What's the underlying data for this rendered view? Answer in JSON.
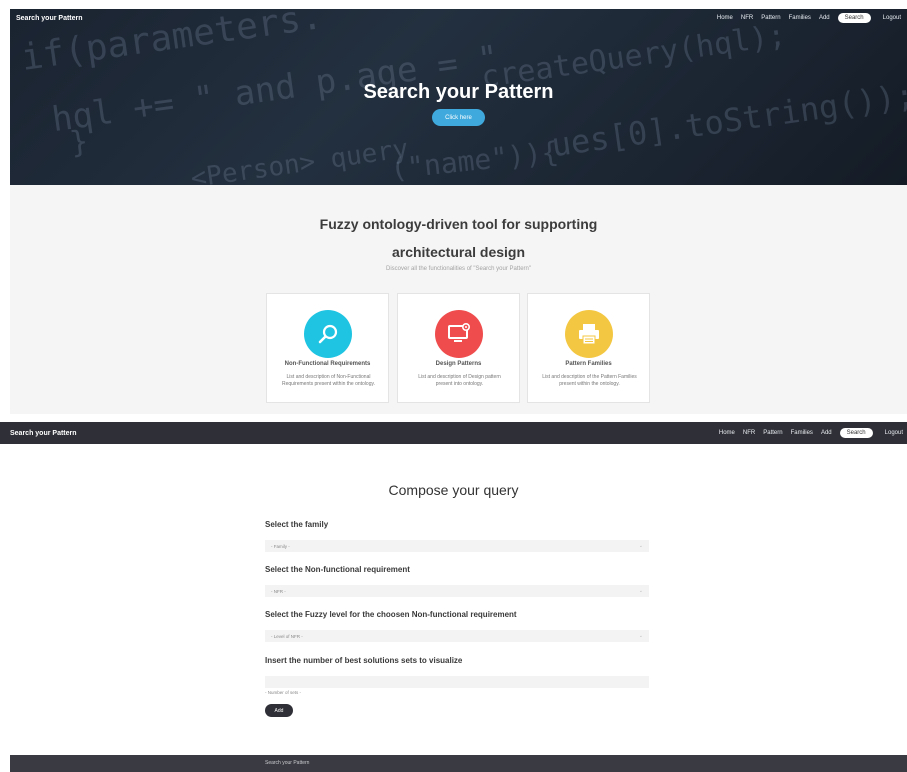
{
  "top_nav": {
    "brand": "Search your Pattern",
    "links": [
      "Home",
      "NFR",
      "Pattern",
      "Families",
      "Add"
    ],
    "search_label": "Search",
    "logout_label": "Logout"
  },
  "hero": {
    "code_text": [
      "if(parameters.",
      "hql += \" and p.age = \"",
      "}",
      "createQuery(hql);",
      "ues[0].toString());",
      "(\"name\")){",
      "<Person> query"
    ],
    "title": "Search your Pattern",
    "button_label": "Click here"
  },
  "features": {
    "title_line1": "Fuzzy ontology-driven tool for supporting",
    "title_line2": "architectural design",
    "subtitle": "Discover all the functionalities of \"Search your Pattern\"",
    "cards": [
      {
        "title": "Non-Functional Requirements",
        "description": "List and description of Non-Functional Requirements present within the ontology.",
        "icon": "search-icon",
        "color": "#1fc4e2"
      },
      {
        "title": "Design Patterns",
        "description": "List and description of Design pattern present into ontology.",
        "icon": "monitor-gear-icon",
        "color": "#ef4d4d"
      },
      {
        "title": "Pattern Families",
        "description": "List and description of the Pattern Families present within the ontology.",
        "icon": "printer-icon",
        "color": "#f4c742"
      }
    ]
  },
  "query": {
    "title": "Compose your query",
    "family_label": "Select the family",
    "family_placeholder": "- Family -",
    "nfr_label": "Select the Non-functional requirement",
    "nfr_placeholder": "- NFR -",
    "level_label": "Select the Fuzzy level for the choosen Non-functional requirement",
    "level_placeholder": "- Level of NFR -",
    "sets_label": "Insert the number of best solutions sets to visualize",
    "sets_hint": "- Number of sets -",
    "add_label": "Add"
  },
  "footer": {
    "text": "Search your Pattern"
  },
  "colors": {
    "nav_dark": "#2f3037",
    "hero_button": "#3fa9dd",
    "section_bg": "#f5f5f5"
  }
}
